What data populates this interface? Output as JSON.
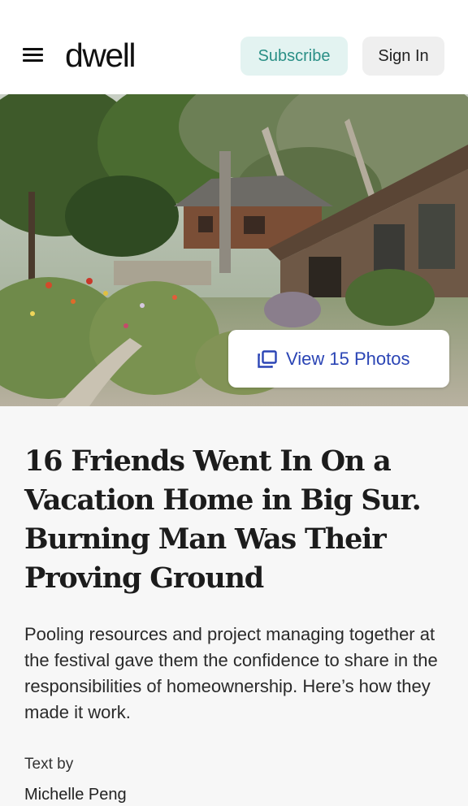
{
  "header": {
    "menu_icon": "hamburger-menu-icon",
    "logo_text": "dwell",
    "subscribe_label": "Subscribe",
    "signin_label": "Sign In",
    "colors": {
      "subscribe_bg": "#e3f3f1",
      "subscribe_text": "#2a8f86",
      "signin_bg": "#efefef"
    }
  },
  "hero": {
    "view_photos_icon": "photo-gallery-icon",
    "view_photos_label": "View 15 Photos",
    "view_photos_color": "#2b45b5"
  },
  "article": {
    "headline": "16 Friends Went In On a Vacation Home in Big Sur. Burning Man Was Their Proving Ground",
    "dek": "Pooling resources and project managing together at the festival gave them the confidence to share in the responsibilities of homeownership. Here’s how they made it work.",
    "byline_label": "Text by",
    "author": "Michelle Peng"
  }
}
